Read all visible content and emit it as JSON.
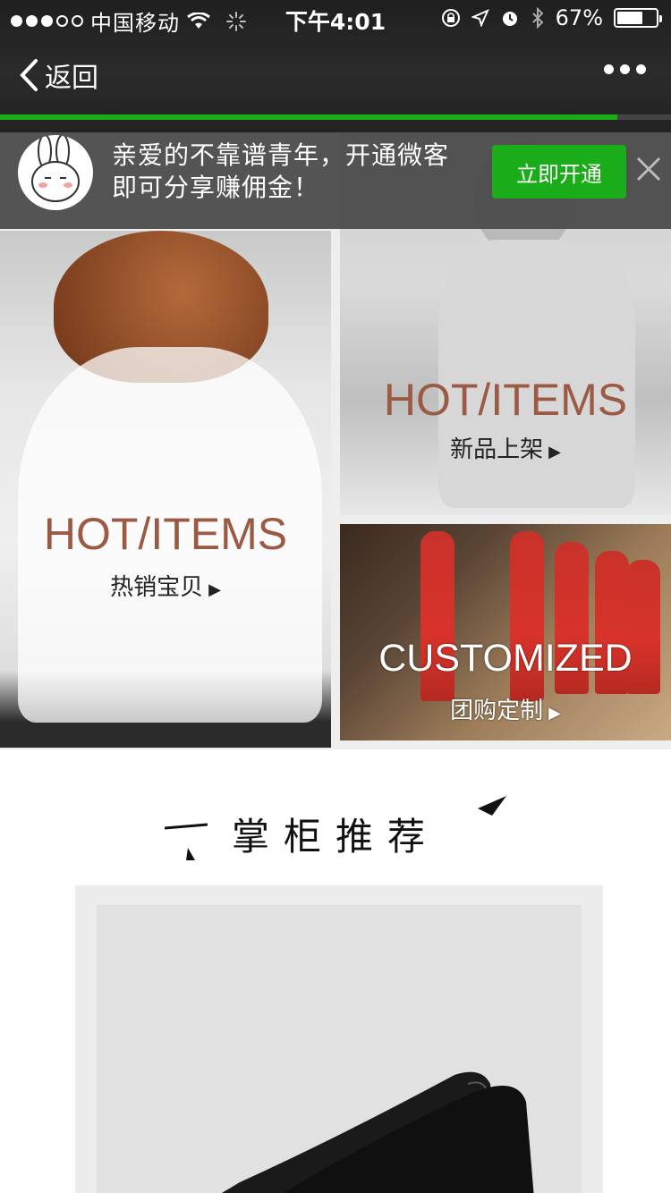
{
  "status_bar": {
    "carrier": "中国移动",
    "time": "下午4:01",
    "battery": "67%",
    "battery_level": 0.67
  },
  "nav": {
    "back_label": "返回",
    "more_icon": "more-dots-icon"
  },
  "page_load_progress": 0.92,
  "banner": {
    "message_line1": "亲爱的不靠谱青年，开通微客",
    "message_line2": "即可分享赚佣金！",
    "button_label": "立即开通",
    "accent_color": "#1aad19"
  },
  "tiles": [
    {
      "heading": "HOT/ITEMS",
      "label": "热销宝贝"
    },
    {
      "heading": "HOT/ITEMS",
      "label": "新品上架"
    },
    {
      "heading": "CUSTOMIZED",
      "label": "团购定制"
    }
  ],
  "section": {
    "title": "掌柜推荐"
  }
}
